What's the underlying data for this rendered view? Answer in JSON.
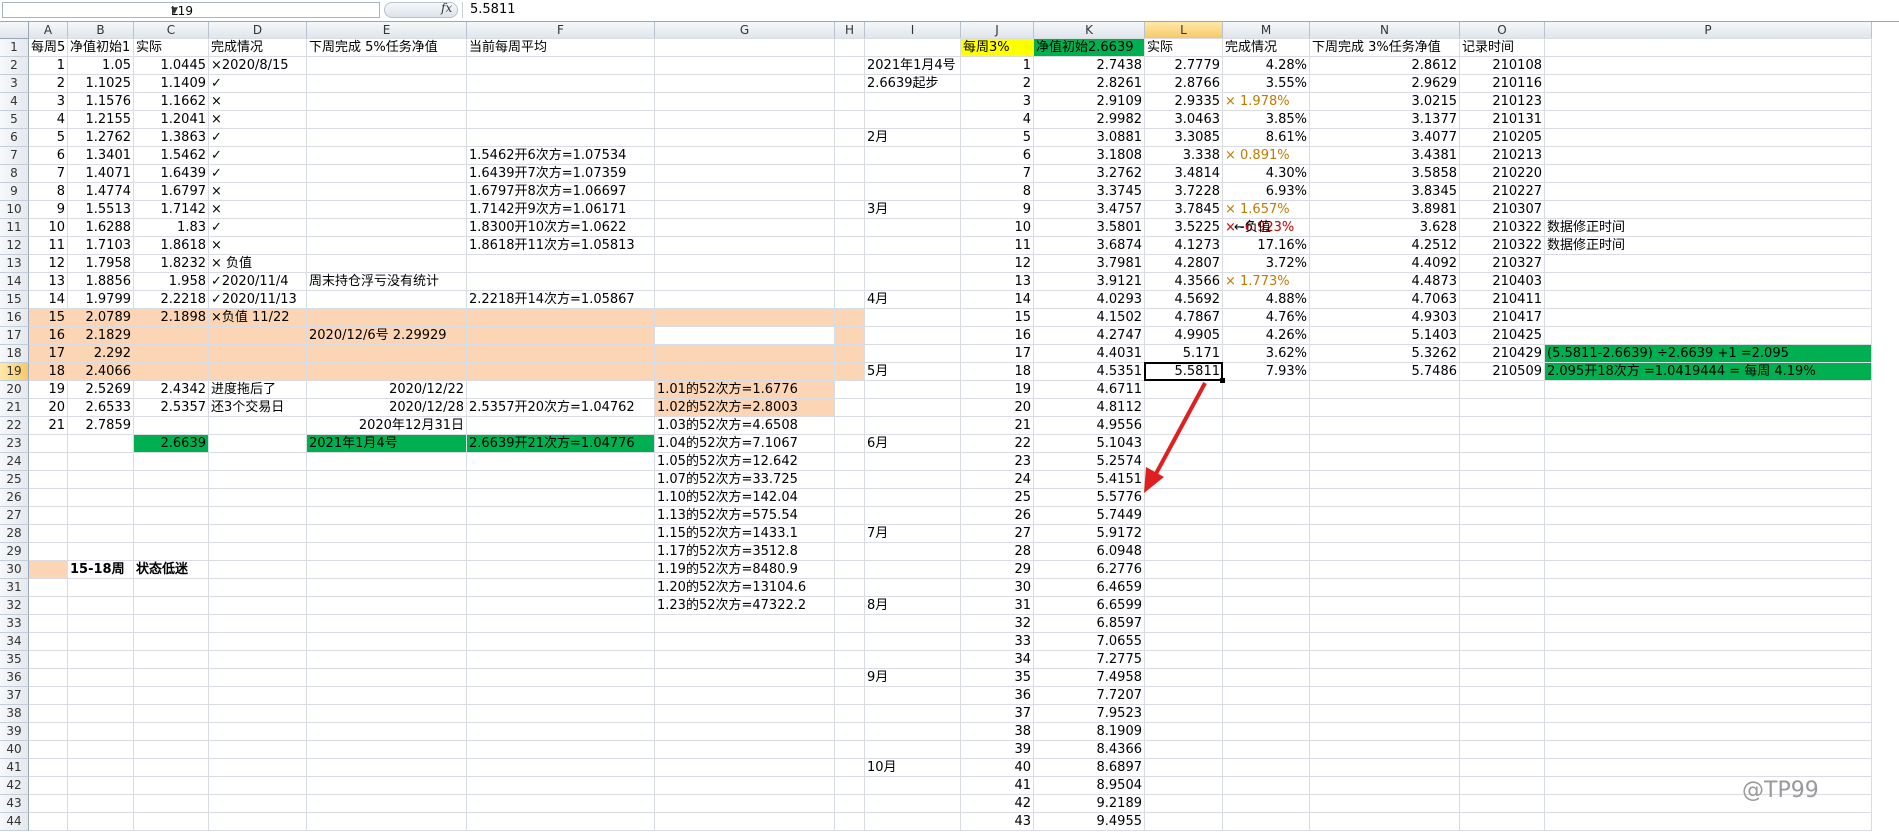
{
  "formula_bar": {
    "name_box": "L19",
    "fx_label": "fx",
    "formula": "5.5811"
  },
  "columns": [
    {
      "label": "A"
    },
    {
      "label": "B"
    },
    {
      "label": "C"
    },
    {
      "label": "D"
    },
    {
      "label": "E"
    },
    {
      "label": "F"
    },
    {
      "label": "G"
    },
    {
      "label": "H"
    },
    {
      "label": "I"
    },
    {
      "label": "J"
    },
    {
      "label": "K"
    },
    {
      "label": "L"
    },
    {
      "label": "M"
    },
    {
      "label": "N"
    },
    {
      "label": "O"
    },
    {
      "label": "P"
    }
  ],
  "row_count": 44,
  "selected_cell": {
    "col": "L",
    "row": 19
  },
  "colors": {
    "peach": "#fcd5b4",
    "green": "#00b050",
    "yellow": "#ffff00",
    "orange_text": "#c07a00",
    "red_text": "#c00000",
    "arrow": "#e02020"
  },
  "cells": [
    {
      "ref": "A1",
      "v": "每周5"
    },
    {
      "ref": "B1",
      "v": "净值初始1"
    },
    {
      "ref": "C1",
      "v": "实际"
    },
    {
      "ref": "D1",
      "v": "完成情况"
    },
    {
      "ref": "E1",
      "v": "下周完成 5%任务净值"
    },
    {
      "ref": "F1",
      "v": "当前每周平均"
    },
    {
      "ref": "A2",
      "v": "1",
      "a": "r"
    },
    {
      "ref": "B2",
      "v": "1.05",
      "a": "r"
    },
    {
      "ref": "C2",
      "v": "1.0445",
      "a": "r"
    },
    {
      "ref": "D2",
      "v": "×2020/8/15"
    },
    {
      "ref": "A3",
      "v": "2",
      "a": "r"
    },
    {
      "ref": "B3",
      "v": "1.1025",
      "a": "r"
    },
    {
      "ref": "C3",
      "v": "1.1409",
      "a": "r"
    },
    {
      "ref": "D3",
      "v": "✓"
    },
    {
      "ref": "A4",
      "v": "3",
      "a": "r"
    },
    {
      "ref": "B4",
      "v": "1.1576",
      "a": "r"
    },
    {
      "ref": "C4",
      "v": "1.1662",
      "a": "r"
    },
    {
      "ref": "D4",
      "v": "×"
    },
    {
      "ref": "A5",
      "v": "4",
      "a": "r"
    },
    {
      "ref": "B5",
      "v": "1.2155",
      "a": "r"
    },
    {
      "ref": "C5",
      "v": "1.2041",
      "a": "r"
    },
    {
      "ref": "D5",
      "v": "×"
    },
    {
      "ref": "A6",
      "v": "5",
      "a": "r"
    },
    {
      "ref": "B6",
      "v": "1.2762",
      "a": "r"
    },
    {
      "ref": "C6",
      "v": "1.3863",
      "a": "r"
    },
    {
      "ref": "D6",
      "v": "✓"
    },
    {
      "ref": "A7",
      "v": "6",
      "a": "r"
    },
    {
      "ref": "B7",
      "v": "1.3401",
      "a": "r"
    },
    {
      "ref": "C7",
      "v": "1.5462",
      "a": "r"
    },
    {
      "ref": "D7",
      "v": "✓"
    },
    {
      "ref": "F7",
      "v": "1.5462开6次方=1.07534"
    },
    {
      "ref": "A8",
      "v": "7",
      "a": "r"
    },
    {
      "ref": "B8",
      "v": "1.4071",
      "a": "r"
    },
    {
      "ref": "C8",
      "v": "1.6439",
      "a": "r"
    },
    {
      "ref": "D8",
      "v": "✓"
    },
    {
      "ref": "F8",
      "v": "1.6439开7次方=1.07359"
    },
    {
      "ref": "A9",
      "v": "8",
      "a": "r"
    },
    {
      "ref": "B9",
      "v": "1.4774",
      "a": "r"
    },
    {
      "ref": "C9",
      "v": "1.6797",
      "a": "r"
    },
    {
      "ref": "D9",
      "v": "×"
    },
    {
      "ref": "F9",
      "v": "1.6797开8次方=1.06697"
    },
    {
      "ref": "A10",
      "v": "9",
      "a": "r"
    },
    {
      "ref": "B10",
      "v": "1.5513",
      "a": "r"
    },
    {
      "ref": "C10",
      "v": "1.7142",
      "a": "r"
    },
    {
      "ref": "D10",
      "v": "×"
    },
    {
      "ref": "F10",
      "v": "1.7142开9次方=1.06171"
    },
    {
      "ref": "A11",
      "v": "10",
      "a": "r"
    },
    {
      "ref": "B11",
      "v": "1.6288",
      "a": "r"
    },
    {
      "ref": "C11",
      "v": "1.83",
      "a": "r"
    },
    {
      "ref": "D11",
      "v": "✓"
    },
    {
      "ref": "F11",
      "v": "1.8300开10次方=1.0622"
    },
    {
      "ref": "A12",
      "v": "11",
      "a": "r"
    },
    {
      "ref": "B12",
      "v": "1.7103",
      "a": "r"
    },
    {
      "ref": "C12",
      "v": "1.8618",
      "a": "r"
    },
    {
      "ref": "D12",
      "v": "×"
    },
    {
      "ref": "F12",
      "v": "1.8618开11次方=1.05813"
    },
    {
      "ref": "A13",
      "v": "12",
      "a": "r"
    },
    {
      "ref": "B13",
      "v": "1.7958",
      "a": "r"
    },
    {
      "ref": "C13",
      "v": "1.8232",
      "a": "r"
    },
    {
      "ref": "D13",
      "v": "×  负值"
    },
    {
      "ref": "A14",
      "v": "13",
      "a": "r"
    },
    {
      "ref": "B14",
      "v": "1.8856",
      "a": "r"
    },
    {
      "ref": "C14",
      "v": "1.958",
      "a": "r"
    },
    {
      "ref": "D14",
      "v": "✓2020/11/4"
    },
    {
      "ref": "E14",
      "v": "周末持仓浮亏没有统计"
    },
    {
      "ref": "A15",
      "v": "14",
      "a": "r"
    },
    {
      "ref": "B15",
      "v": "1.9799",
      "a": "r"
    },
    {
      "ref": "C15",
      "v": "2.2218",
      "a": "r"
    },
    {
      "ref": "D15",
      "v": "✓2020/11/13"
    },
    {
      "ref": "F15",
      "v": "2.2218开14次方=1.05867"
    },
    {
      "ref": "A16",
      "v": "15",
      "a": "r"
    },
    {
      "ref": "B16",
      "v": "2.0789",
      "a": "r"
    },
    {
      "ref": "C16",
      "v": "2.1898",
      "a": "r"
    },
    {
      "ref": "D16",
      "v": "×负值 11/22"
    },
    {
      "ref": "A17",
      "v": "16",
      "a": "r"
    },
    {
      "ref": "B17",
      "v": "2.1829",
      "a": "r"
    },
    {
      "ref": "E17",
      "v": "2020/12/6号 2.29929"
    },
    {
      "ref": "A18",
      "v": "17",
      "a": "r"
    },
    {
      "ref": "B18",
      "v": "2.292",
      "a": "r"
    },
    {
      "ref": "A19",
      "v": "18",
      "a": "r"
    },
    {
      "ref": "B19",
      "v": "2.4066",
      "a": "r"
    },
    {
      "ref": "A20",
      "v": "19",
      "a": "r"
    },
    {
      "ref": "B20",
      "v": "2.5269",
      "a": "r"
    },
    {
      "ref": "C20",
      "v": "2.4342",
      "a": "r"
    },
    {
      "ref": "D20",
      "v": "进度拖后了"
    },
    {
      "ref": "E20",
      "v": "2020/12/22",
      "a": "r"
    },
    {
      "ref": "G20",
      "v": "1.01的52次方=1.6776"
    },
    {
      "ref": "A21",
      "v": "20",
      "a": "r"
    },
    {
      "ref": "B21",
      "v": "2.6533",
      "a": "r"
    },
    {
      "ref": "C21",
      "v": "2.5357",
      "a": "r"
    },
    {
      "ref": "D21",
      "v": "还3个交易日"
    },
    {
      "ref": "E21",
      "v": "2020/12/28",
      "a": "r"
    },
    {
      "ref": "F21",
      "v": "2.5357开20次方=1.04762"
    },
    {
      "ref": "G21",
      "v": "1.02的52次方=2.8003"
    },
    {
      "ref": "A22",
      "v": "21",
      "a": "r"
    },
    {
      "ref": "B22",
      "v": "2.7859",
      "a": "r"
    },
    {
      "ref": "E22",
      "v": "2020年12月31日",
      "a": "r"
    },
    {
      "ref": "G22",
      "v": "1.03的52次方=4.6508"
    },
    {
      "ref": "C23",
      "v": "2.6639",
      "a": "r"
    },
    {
      "ref": "E23",
      "v": "2021年1月4号"
    },
    {
      "ref": "F23",
      "v": "2.6639开21次方=1.04776"
    },
    {
      "ref": "G23",
      "v": "1.04的52次方=7.1067"
    },
    {
      "ref": "G24",
      "v": "1.05的52次方=12.642"
    },
    {
      "ref": "G25",
      "v": "1.07的52次方=33.725"
    },
    {
      "ref": "G26",
      "v": "1.10的52次方=142.04"
    },
    {
      "ref": "G27",
      "v": "1.13的52次方=575.54"
    },
    {
      "ref": "G28",
      "v": "1.15的52次方=1433.1"
    },
    {
      "ref": "G29",
      "v": "1.17的52次方=3512.8"
    },
    {
      "ref": "G30",
      "v": "1.19的52次方=8480.9"
    },
    {
      "ref": "B30",
      "v": "15-18周",
      "b": true
    },
    {
      "ref": "C30",
      "v": "状态低迷",
      "b": true
    },
    {
      "ref": "G31",
      "v": "1.20的52次方=13104.6"
    },
    {
      "ref": "G32",
      "v": "1.23的52次方=47322.2"
    },
    {
      "ref": "I2",
      "v": "2021年1月4号"
    },
    {
      "ref": "I3",
      "v": "2.6639起步"
    },
    {
      "ref": "I6",
      "v": "2月"
    },
    {
      "ref": "I10",
      "v": "3月"
    },
    {
      "ref": "I15",
      "v": "4月"
    },
    {
      "ref": "I19",
      "v": "5月"
    },
    {
      "ref": "I23",
      "v": "6月"
    },
    {
      "ref": "I28",
      "v": "7月"
    },
    {
      "ref": "I32",
      "v": "8月"
    },
    {
      "ref": "I36",
      "v": "9月"
    },
    {
      "ref": "I41",
      "v": "10月"
    },
    {
      "ref": "J1",
      "v": "每周3%"
    },
    {
      "ref": "K1",
      "v": "净值初始2.6639"
    },
    {
      "ref": "L1",
      "v": "实际"
    },
    {
      "ref": "M1",
      "v": "完成情况"
    },
    {
      "ref": "N1",
      "v": "下周完成 3%任务净值"
    },
    {
      "ref": "O1",
      "v": "记录时间"
    },
    {
      "ref": "J2",
      "v": "1",
      "a": "r"
    },
    {
      "ref": "K2",
      "v": "2.7438",
      "a": "r"
    },
    {
      "ref": "L2",
      "v": "2.7779",
      "a": "r"
    },
    {
      "ref": "M2",
      "v": "4.28%",
      "a": "r"
    },
    {
      "ref": "N2",
      "v": "2.8612",
      "a": "r"
    },
    {
      "ref": "O2",
      "v": "210108",
      "a": "r"
    },
    {
      "ref": "J3",
      "v": "2",
      "a": "r"
    },
    {
      "ref": "K3",
      "v": "2.8261",
      "a": "r"
    },
    {
      "ref": "L3",
      "v": "2.8766",
      "a": "r"
    },
    {
      "ref": "M3",
      "v": "3.55%",
      "a": "r"
    },
    {
      "ref": "N3",
      "v": "2.9629",
      "a": "r"
    },
    {
      "ref": "O3",
      "v": "210116",
      "a": "r"
    },
    {
      "ref": "J4",
      "v": "3",
      "a": "r"
    },
    {
      "ref": "K4",
      "v": "2.9109",
      "a": "r"
    },
    {
      "ref": "L4",
      "v": "2.9335",
      "a": "r"
    },
    {
      "ref": "M4",
      "v": "×  1.978%",
      "cls": "orange"
    },
    {
      "ref": "N4",
      "v": "3.0215",
      "a": "r"
    },
    {
      "ref": "O4",
      "v": "210123",
      "a": "r"
    },
    {
      "ref": "J5",
      "v": "4",
      "a": "r"
    },
    {
      "ref": "K5",
      "v": "2.9982",
      "a": "r"
    },
    {
      "ref": "L5",
      "v": "3.0463",
      "a": "r"
    },
    {
      "ref": "M5",
      "v": "3.85%",
      "a": "r"
    },
    {
      "ref": "N5",
      "v": "3.1377",
      "a": "r"
    },
    {
      "ref": "O5",
      "v": "210131",
      "a": "r"
    },
    {
      "ref": "J6",
      "v": "5",
      "a": "r"
    },
    {
      "ref": "K6",
      "v": "3.0881",
      "a": "r"
    },
    {
      "ref": "L6",
      "v": "3.3085",
      "a": "r"
    },
    {
      "ref": "M6",
      "v": "8.61%",
      "a": "r"
    },
    {
      "ref": "N6",
      "v": "3.4077",
      "a": "r"
    },
    {
      "ref": "O6",
      "v": "210205",
      "a": "r"
    },
    {
      "ref": "J7",
      "v": "6",
      "a": "r"
    },
    {
      "ref": "K7",
      "v": "3.1808",
      "a": "r"
    },
    {
      "ref": "L7",
      "v": "3.338",
      "a": "r"
    },
    {
      "ref": "M7",
      "v": "×  0.891%",
      "cls": "orange"
    },
    {
      "ref": "N7",
      "v": "3.4381",
      "a": "r"
    },
    {
      "ref": "O7",
      "v": "210213",
      "a": "r"
    },
    {
      "ref": "J8",
      "v": "7",
      "a": "r"
    },
    {
      "ref": "K8",
      "v": "3.2762",
      "a": "r"
    },
    {
      "ref": "L8",
      "v": "3.4814",
      "a": "r"
    },
    {
      "ref": "M8",
      "v": "4.30%",
      "a": "r"
    },
    {
      "ref": "N8",
      "v": "3.5858",
      "a": "r"
    },
    {
      "ref": "O8",
      "v": "210220",
      "a": "r"
    },
    {
      "ref": "J9",
      "v": "8",
      "a": "r"
    },
    {
      "ref": "K9",
      "v": "3.3745",
      "a": "r"
    },
    {
      "ref": "L9",
      "v": "3.7228",
      "a": "r"
    },
    {
      "ref": "M9",
      "v": "6.93%",
      "a": "r"
    },
    {
      "ref": "N9",
      "v": "3.8345",
      "a": "r"
    },
    {
      "ref": "O9",
      "v": "210227",
      "a": "r"
    },
    {
      "ref": "J10",
      "v": "9",
      "a": "r"
    },
    {
      "ref": "K10",
      "v": "3.4757",
      "a": "r"
    },
    {
      "ref": "L10",
      "v": "3.7845",
      "a": "r"
    },
    {
      "ref": "M10",
      "v": "×  1.657%",
      "cls": "orange"
    },
    {
      "ref": "N10",
      "v": "3.8981",
      "a": "r"
    },
    {
      "ref": "O10",
      "v": "210307",
      "a": "r"
    },
    {
      "ref": "J11",
      "v": "10",
      "a": "r"
    },
    {
      "ref": "K11",
      "v": "3.5801",
      "a": "r"
    },
    {
      "ref": "L11",
      "v": "3.5225",
      "a": "r"
    },
    {
      "ref": "M11",
      "v": "×  -6.923%",
      "cls": "red"
    },
    {
      "ref": "N11",
      "v": "3.628",
      "a": "r"
    },
    {
      "ref": "O11",
      "v": "210322",
      "a": "r"
    },
    {
      "ref": "M11b",
      "v": "←负值"
    },
    {
      "ref": "P11",
      "v": "数据修正时间"
    },
    {
      "ref": "J12",
      "v": "11",
      "a": "r"
    },
    {
      "ref": "K12",
      "v": "3.6874",
      "a": "r"
    },
    {
      "ref": "L12",
      "v": "4.1273",
      "a": "r"
    },
    {
      "ref": "M12",
      "v": "17.16%",
      "a": "r"
    },
    {
      "ref": "N12",
      "v": "4.2512",
      "a": "r"
    },
    {
      "ref": "O12",
      "v": "210322",
      "a": "r"
    },
    {
      "ref": "P12",
      "v": "数据修正时间"
    },
    {
      "ref": "J13",
      "v": "12",
      "a": "r"
    },
    {
      "ref": "K13",
      "v": "3.7981",
      "a": "r"
    },
    {
      "ref": "L13",
      "v": "4.2807",
      "a": "r"
    },
    {
      "ref": "M13",
      "v": "3.72%",
      "a": "r"
    },
    {
      "ref": "N13",
      "v": "4.4092",
      "a": "r"
    },
    {
      "ref": "O13",
      "v": "210327",
      "a": "r"
    },
    {
      "ref": "J14",
      "v": "13",
      "a": "r"
    },
    {
      "ref": "K14",
      "v": "3.9121",
      "a": "r"
    },
    {
      "ref": "L14",
      "v": "4.3566",
      "a": "r"
    },
    {
      "ref": "M14",
      "v": "×  1.773%",
      "cls": "orange"
    },
    {
      "ref": "N14",
      "v": "4.4873",
      "a": "r"
    },
    {
      "ref": "O14",
      "v": "210403",
      "a": "r"
    },
    {
      "ref": "J15",
      "v": "14",
      "a": "r"
    },
    {
      "ref": "K15",
      "v": "4.0293",
      "a": "r"
    },
    {
      "ref": "L15",
      "v": "4.5692",
      "a": "r"
    },
    {
      "ref": "M15",
      "v": "4.88%",
      "a": "r"
    },
    {
      "ref": "N15",
      "v": "4.7063",
      "a": "r"
    },
    {
      "ref": "O15",
      "v": "210411",
      "a": "r"
    },
    {
      "ref": "J16",
      "v": "15",
      "a": "r"
    },
    {
      "ref": "K16",
      "v": "4.1502",
      "a": "r"
    },
    {
      "ref": "L16",
      "v": "4.7867",
      "a": "r"
    },
    {
      "ref": "M16",
      "v": "4.76%",
      "a": "r"
    },
    {
      "ref": "N16",
      "v": "4.9303",
      "a": "r"
    },
    {
      "ref": "O16",
      "v": "210417",
      "a": "r"
    },
    {
      "ref": "J17",
      "v": "16",
      "a": "r"
    },
    {
      "ref": "K17",
      "v": "4.2747",
      "a": "r"
    },
    {
      "ref": "L17",
      "v": "4.9905",
      "a": "r"
    },
    {
      "ref": "M17",
      "v": "4.26%",
      "a": "r"
    },
    {
      "ref": "N17",
      "v": "5.1403",
      "a": "r"
    },
    {
      "ref": "O17",
      "v": "210425",
      "a": "r"
    },
    {
      "ref": "J18",
      "v": "17",
      "a": "r"
    },
    {
      "ref": "K18",
      "v": "4.4031",
      "a": "r"
    },
    {
      "ref": "L18",
      "v": "5.171",
      "a": "r"
    },
    {
      "ref": "M18",
      "v": "3.62%",
      "a": "r"
    },
    {
      "ref": "N18",
      "v": "5.3262",
      "a": "r"
    },
    {
      "ref": "O18",
      "v": "210429",
      "a": "r"
    },
    {
      "ref": "P18",
      "v": "(5.5811-2.6639) ÷2.6639 +1 =2.095"
    },
    {
      "ref": "J19",
      "v": "18",
      "a": "r"
    },
    {
      "ref": "K19",
      "v": "4.5351",
      "a": "r"
    },
    {
      "ref": "L19",
      "v": "5.5811",
      "a": "r"
    },
    {
      "ref": "M19",
      "v": "7.93%",
      "a": "r"
    },
    {
      "ref": "N19",
      "v": "5.7486",
      "a": "r"
    },
    {
      "ref": "O19",
      "v": "210509",
      "a": "r"
    },
    {
      "ref": "P19",
      "v": "2.095开18次方 =1.0419444 = 每周 4.19%"
    },
    {
      "ref": "J20",
      "v": "19",
      "a": "r"
    },
    {
      "ref": "K20",
      "v": "4.6711",
      "a": "r"
    },
    {
      "ref": "J21",
      "v": "20",
      "a": "r"
    },
    {
      "ref": "K21",
      "v": "4.8112",
      "a": "r"
    },
    {
      "ref": "J22",
      "v": "21",
      "a": "r"
    },
    {
      "ref": "K22",
      "v": "4.9556",
      "a": "r"
    },
    {
      "ref": "J23",
      "v": "22",
      "a": "r"
    },
    {
      "ref": "K23",
      "v": "5.1043",
      "a": "r"
    },
    {
      "ref": "J24",
      "v": "23",
      "a": "r"
    },
    {
      "ref": "K24",
      "v": "5.2574",
      "a": "r"
    },
    {
      "ref": "J25",
      "v": "24",
      "a": "r"
    },
    {
      "ref": "K25",
      "v": "5.4151",
      "a": "r"
    },
    {
      "ref": "J26",
      "v": "25",
      "a": "r"
    },
    {
      "ref": "K26",
      "v": "5.5776",
      "a": "r"
    },
    {
      "ref": "J27",
      "v": "26",
      "a": "r"
    },
    {
      "ref": "K27",
      "v": "5.7449",
      "a": "r"
    },
    {
      "ref": "J28",
      "v": "27",
      "a": "r"
    },
    {
      "ref": "K28",
      "v": "5.9172",
      "a": "r"
    },
    {
      "ref": "J29",
      "v": "28",
      "a": "r"
    },
    {
      "ref": "K29",
      "v": "6.0948",
      "a": "r"
    },
    {
      "ref": "J30",
      "v": "29",
      "a": "r"
    },
    {
      "ref": "K30",
      "v": "6.2776",
      "a": "r"
    },
    {
      "ref": "J31",
      "v": "30",
      "a": "r"
    },
    {
      "ref": "K31",
      "v": "6.4659",
      "a": "r"
    },
    {
      "ref": "J32",
      "v": "31",
      "a": "r"
    },
    {
      "ref": "K32",
      "v": "6.6599",
      "a": "r"
    },
    {
      "ref": "J33",
      "v": "32",
      "a": "r"
    },
    {
      "ref": "K33",
      "v": "6.8597",
      "a": "r"
    },
    {
      "ref": "J34",
      "v": "33",
      "a": "r"
    },
    {
      "ref": "K34",
      "v": "7.0655",
      "a": "r"
    },
    {
      "ref": "J35",
      "v": "34",
      "a": "r"
    },
    {
      "ref": "K35",
      "v": "7.2775",
      "a": "r"
    },
    {
      "ref": "J36",
      "v": "35",
      "a": "r"
    },
    {
      "ref": "K36",
      "v": "7.4958",
      "a": "r"
    },
    {
      "ref": "J37",
      "v": "36",
      "a": "r"
    },
    {
      "ref": "K37",
      "v": "7.7207",
      "a": "r"
    },
    {
      "ref": "J38",
      "v": "37",
      "a": "r"
    },
    {
      "ref": "K38",
      "v": "7.9523",
      "a": "r"
    },
    {
      "ref": "J39",
      "v": "38",
      "a": "r"
    },
    {
      "ref": "K39",
      "v": "8.1909",
      "a": "r"
    },
    {
      "ref": "J40",
      "v": "39",
      "a": "r"
    },
    {
      "ref": "K40",
      "v": "8.4366",
      "a": "r"
    },
    {
      "ref": "J41",
      "v": "40",
      "a": "r"
    },
    {
      "ref": "K41",
      "v": "8.6897",
      "a": "r"
    },
    {
      "ref": "J42",
      "v": "41",
      "a": "r"
    },
    {
      "ref": "K42",
      "v": "8.9504",
      "a": "r"
    },
    {
      "ref": "J43",
      "v": "42",
      "a": "r"
    },
    {
      "ref": "K43",
      "v": "9.2189",
      "a": "r"
    },
    {
      "ref": "J44",
      "v": "43",
      "a": "r"
    },
    {
      "ref": "K44",
      "v": "9.4955",
      "a": "r"
    }
  ],
  "watermark": "@TP99"
}
